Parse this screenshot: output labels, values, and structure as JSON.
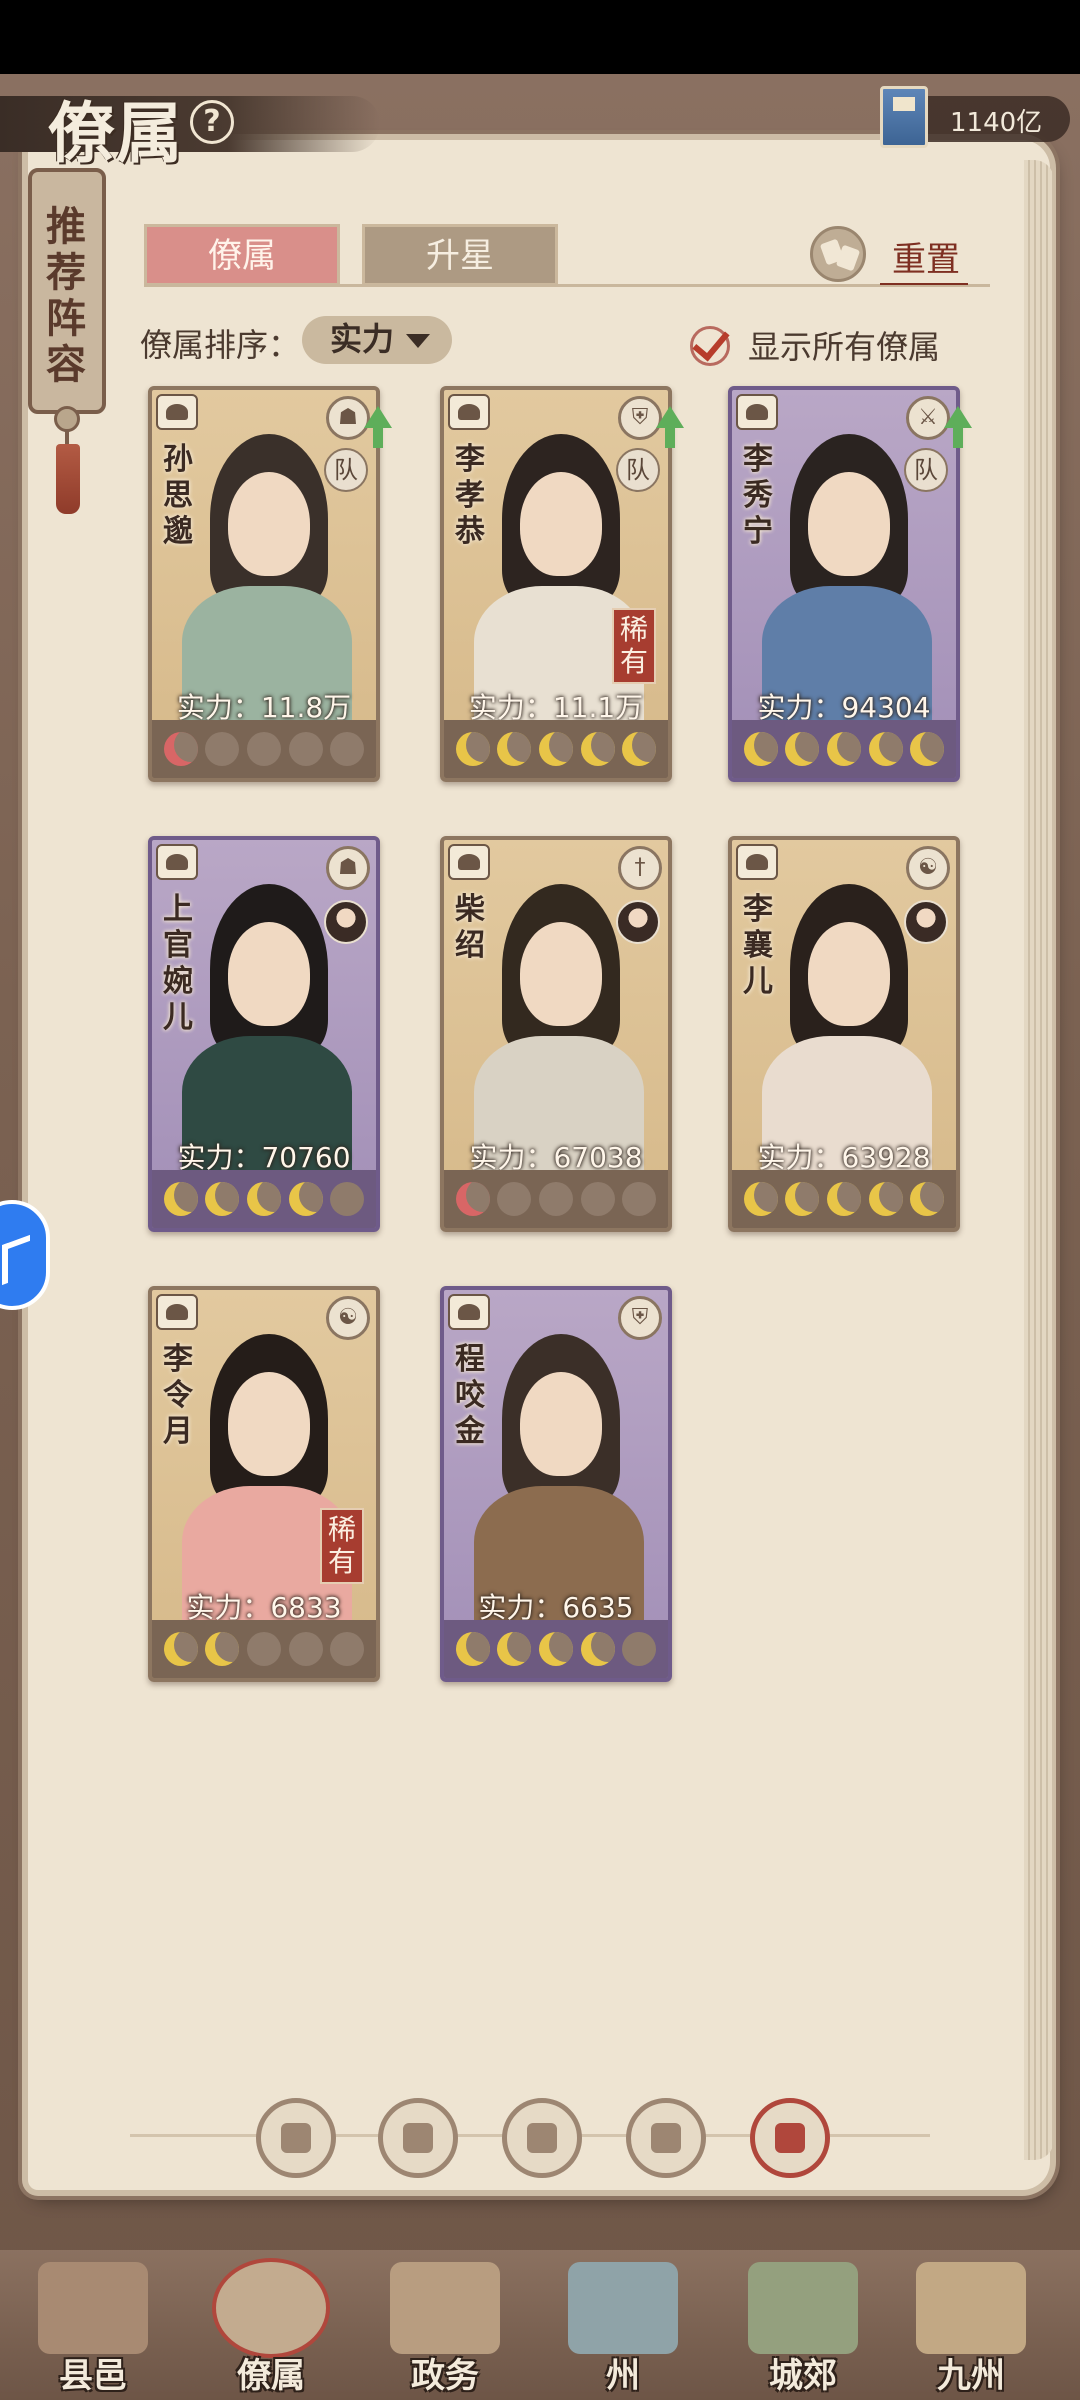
{
  "header": {
    "title": "僚属",
    "help_icon": "question-circle-icon",
    "currency": {
      "icon": "book-icon",
      "value": "1140亿"
    }
  },
  "side_bookmark": {
    "label": "推荐阵容"
  },
  "tabs": [
    {
      "label": "僚属",
      "active": true
    },
    {
      "label": "升星",
      "active": false
    }
  ],
  "reset": {
    "label": "重置",
    "icon": "reset-cards-icon"
  },
  "sort": {
    "label": "僚属排序：",
    "value": "实力"
  },
  "show_all": {
    "label": "显示所有僚属",
    "checked": true
  },
  "cards": [
    {
      "name": "孙思邈",
      "power": "实力：11.8万",
      "stars": [
        "red",
        "off",
        "off",
        "off",
        "off"
      ],
      "badge": "队",
      "class_icon": "hat-icon",
      "upgrade": true,
      "rare": "",
      "theme": "gold"
    },
    {
      "name": "李孝恭",
      "power": "实力：11.1万",
      "stars": [
        "on",
        "on",
        "on",
        "on",
        "on"
      ],
      "badge": "队",
      "class_icon": "shield-icon",
      "upgrade": true,
      "rare": "稀有",
      "theme": "gold"
    },
    {
      "name": "李秀宁",
      "power": "实力：94304",
      "stars": [
        "on",
        "on",
        "on",
        "on",
        "on"
      ],
      "badge": "队",
      "class_icon": "crossed-swords-icon",
      "upgrade": true,
      "rare": "",
      "theme": "purple"
    },
    {
      "name": "上官婉儿",
      "power": "实力：70760",
      "stars": [
        "on",
        "on",
        "on",
        "on",
        "off"
      ],
      "badge": "",
      "class_icon": "hat-icon",
      "upgrade": false,
      "rare": "",
      "theme": "purple"
    },
    {
      "name": "柴绍",
      "power": "实力：67038",
      "stars": [
        "red",
        "off",
        "off",
        "off",
        "off"
      ],
      "badge": "",
      "class_icon": "sword-icon",
      "upgrade": false,
      "rare": "",
      "theme": "gold"
    },
    {
      "name": "李襄儿",
      "power": "实力：63928",
      "stars": [
        "on",
        "on",
        "on",
        "on",
        "on"
      ],
      "badge": "",
      "class_icon": "yin-yang-icon",
      "upgrade": false,
      "rare": "",
      "theme": "gold"
    },
    {
      "name": "李令月",
      "power": "实力：6833",
      "stars": [
        "on",
        "on",
        "off",
        "off",
        "off"
      ],
      "badge": "",
      "class_icon": "yin-yang-icon",
      "upgrade": false,
      "rare": "稀有",
      "theme": "gold"
    },
    {
      "name": "程咬金",
      "power": "实力：6635",
      "stars": [
        "on",
        "on",
        "on",
        "on",
        "off"
      ],
      "badge": "",
      "class_icon": "shield-icon",
      "upgrade": false,
      "rare": "",
      "theme": "purple"
    }
  ],
  "pager": [
    {
      "icon": "diamond-icon",
      "active": false
    },
    {
      "icon": "helmet-icon",
      "active": false
    },
    {
      "icon": "vase-icon",
      "active": false
    },
    {
      "icon": "fan-icon",
      "active": false
    },
    {
      "icon": "lion-icon",
      "active": true
    }
  ],
  "nav": [
    {
      "label": "县邑",
      "active": false
    },
    {
      "label": "僚属",
      "active": true
    },
    {
      "label": "政务",
      "active": false
    },
    {
      "label": "州",
      "active": false
    },
    {
      "label": "城郊",
      "active": false
    },
    {
      "label": "九州",
      "active": false
    }
  ],
  "colors": {
    "tab_active": "#d98f8a",
    "rare_tag": "#a73d30",
    "star_on": "#e8c548",
    "upgrade_arrow": "#5eae5a"
  }
}
